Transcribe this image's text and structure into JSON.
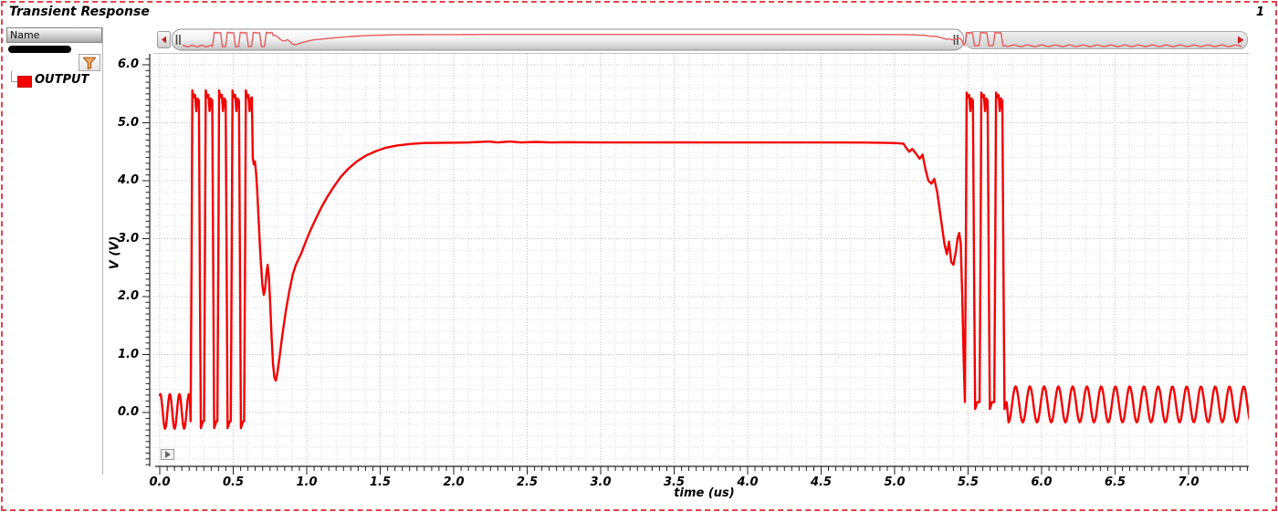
{
  "window": {
    "title": "Transient Response",
    "page_number": "1"
  },
  "sidebar": {
    "header": "Name",
    "signal": {
      "label": "OUTPUT",
      "color": "#f40000",
      "name_redacted": true
    },
    "filter_icon": "funnel-icon"
  },
  "overview_scrollbar": {
    "left_arrow_icon": "scroll-left-arrow-icon",
    "right_arrow_icon": "scroll-right-arrow-icon",
    "grip_icon": "thumb-grip-icon"
  },
  "axes": {
    "x_title": "time (us)",
    "y_title": "V (V)"
  },
  "icons": [
    "funnel-icon",
    "scroll-left-arrow-icon",
    "scroll-right-arrow-icon",
    "play-icon"
  ],
  "colors": {
    "trace": "#f40000",
    "mini_trace": "#e85b5b",
    "marquee": "#e4404c",
    "grid_minor": "#dcdcdc",
    "grid_major": "#bfbfbf",
    "ruler": "#222222"
  },
  "chart_data": {
    "type": "line",
    "title": "Transient Response",
    "xlabel": "time (us)",
    "ylabel": "V (V)",
    "xlim": [
      -0.04,
      7.42
    ],
    "ylim": [
      -0.93,
      6.19
    ],
    "grid": true,
    "legend_position": "left-panel",
    "x_ticks": [
      0.0,
      0.5,
      1.0,
      1.5,
      2.0,
      2.5,
      3.0,
      3.5,
      4.0,
      4.5,
      5.0,
      5.5,
      6.0,
      6.5,
      7.0
    ],
    "x_tick_labels": [
      "0.0",
      "0.5",
      "1.0",
      "1.5",
      "2.0",
      "2.5",
      "3.0",
      "3.5",
      "4.0",
      "4.5",
      "5.0",
      "5.5",
      "6.0",
      "6.5",
      "7.0"
    ],
    "y_ticks": [
      0.0,
      1.0,
      2.0,
      3.0,
      4.0,
      5.0,
      6.0
    ],
    "y_tick_labels": [
      "0.0",
      "1.0",
      "2.0",
      "3.0",
      "4.0",
      "5.0",
      "6.0"
    ],
    "x_minor_step": 0.05,
    "x_grid_step": 0.1,
    "y_minor_step": 0.1,
    "y_grid_step": 0.2,
    "series": [
      {
        "name": "OUTPUT",
        "color": "#f40000",
        "segments": [
          {
            "type": "sine",
            "t0": 0.0,
            "t1": 0.205,
            "mean": 0.02,
            "amp": 0.3,
            "period": 0.065,
            "phase_deg": 70
          },
          {
            "type": "square",
            "t0": 0.21,
            "t1": 0.628,
            "period": 0.091,
            "duty": 0.62,
            "rise": 0.012,
            "fall": 0.013,
            "low": -0.15,
            "high": 5.44,
            "overshoot": 5.56
          },
          {
            "type": "points",
            "pts": [
              [
                0.627,
                5.44
              ],
              [
                0.633,
                4.4
              ],
              [
                0.64,
                4.28
              ],
              [
                0.648,
                4.33
              ],
              [
                0.655,
                4.14
              ],
              [
                0.663,
                3.85
              ],
              [
                0.673,
                3.3
              ],
              [
                0.685,
                2.7
              ],
              [
                0.698,
                2.2
              ],
              [
                0.708,
                2.03
              ],
              [
                0.716,
                2.12
              ],
              [
                0.727,
                2.42
              ],
              [
                0.734,
                2.55
              ],
              [
                0.742,
                2.35
              ],
              [
                0.75,
                1.95
              ],
              [
                0.76,
                1.35
              ],
              [
                0.77,
                0.85
              ],
              [
                0.78,
                0.6
              ],
              [
                0.79,
                0.55
              ],
              [
                0.8,
                0.68
              ],
              [
                0.815,
                0.95
              ],
              [
                0.835,
                1.35
              ],
              [
                0.858,
                1.75
              ],
              [
                0.882,
                2.1
              ],
              [
                0.905,
                2.38
              ],
              [
                0.925,
                2.54
              ],
              [
                0.943,
                2.64
              ],
              [
                0.962,
                2.74
              ],
              [
                0.98,
                2.86
              ],
              [
                1.0,
                2.99
              ],
              [
                1.03,
                3.17
              ],
              [
                1.065,
                3.36
              ],
              [
                1.1,
                3.54
              ],
              [
                1.14,
                3.72
              ],
              [
                1.18,
                3.88
              ],
              [
                1.23,
                4.06
              ],
              [
                1.28,
                4.2
              ],
              [
                1.34,
                4.33
              ],
              [
                1.4,
                4.43
              ],
              [
                1.47,
                4.51
              ],
              [
                1.54,
                4.57
              ],
              [
                1.62,
                4.61
              ],
              [
                1.71,
                4.635
              ],
              [
                1.8,
                4.65
              ],
              [
                1.95,
                4.655
              ],
              [
                2.1,
                4.66
              ],
              [
                2.24,
                4.675
              ],
              [
                2.3,
                4.66
              ],
              [
                2.38,
                4.675
              ],
              [
                2.46,
                4.66
              ],
              [
                2.56,
                4.67
              ],
              [
                2.66,
                4.66
              ],
              [
                2.78,
                4.665
              ],
              [
                3.0,
                4.66
              ],
              [
                3.3,
                4.66
              ],
              [
                3.6,
                4.662
              ],
              [
                3.9,
                4.66
              ],
              [
                4.2,
                4.66
              ],
              [
                4.5,
                4.66
              ],
              [
                4.8,
                4.658
              ],
              [
                5.0,
                4.65
              ],
              [
                5.06,
                4.64
              ],
              [
                5.08,
                4.56
              ],
              [
                5.1,
                4.5
              ],
              [
                5.12,
                4.55
              ],
              [
                5.15,
                4.45
              ],
              [
                5.17,
                4.38
              ],
              [
                5.19,
                4.45
              ],
              [
                5.21,
                4.2
              ],
              [
                5.23,
                4.0
              ],
              [
                5.25,
                3.95
              ],
              [
                5.27,
                4.03
              ],
              [
                5.29,
                3.8
              ],
              [
                5.315,
                3.35
              ],
              [
                5.34,
                2.9
              ],
              [
                5.355,
                2.73
              ],
              [
                5.37,
                2.95
              ],
              [
                5.385,
                2.6
              ],
              [
                5.4,
                2.55
              ],
              [
                5.415,
                2.75
              ],
              [
                5.43,
                3.02
              ],
              [
                5.44,
                3.1
              ],
              [
                5.45,
                2.9
              ],
              [
                5.46,
                2.0
              ],
              [
                5.47,
                0.9
              ],
              [
                5.476,
                0.4
              ]
            ]
          },
          {
            "type": "square",
            "t0": 5.478,
            "t1": 5.77,
            "period": 0.1,
            "duty": 0.55,
            "rise": 0.012,
            "fall": 0.015,
            "low": 0.18,
            "high": 5.44,
            "overshoot": 5.52
          },
          {
            "type": "sine",
            "t0": 5.775,
            "t1": 7.42,
            "mean": 0.14,
            "amp": 0.31,
            "period": 0.097,
            "phase_deg": -90
          }
        ]
      }
    ]
  }
}
